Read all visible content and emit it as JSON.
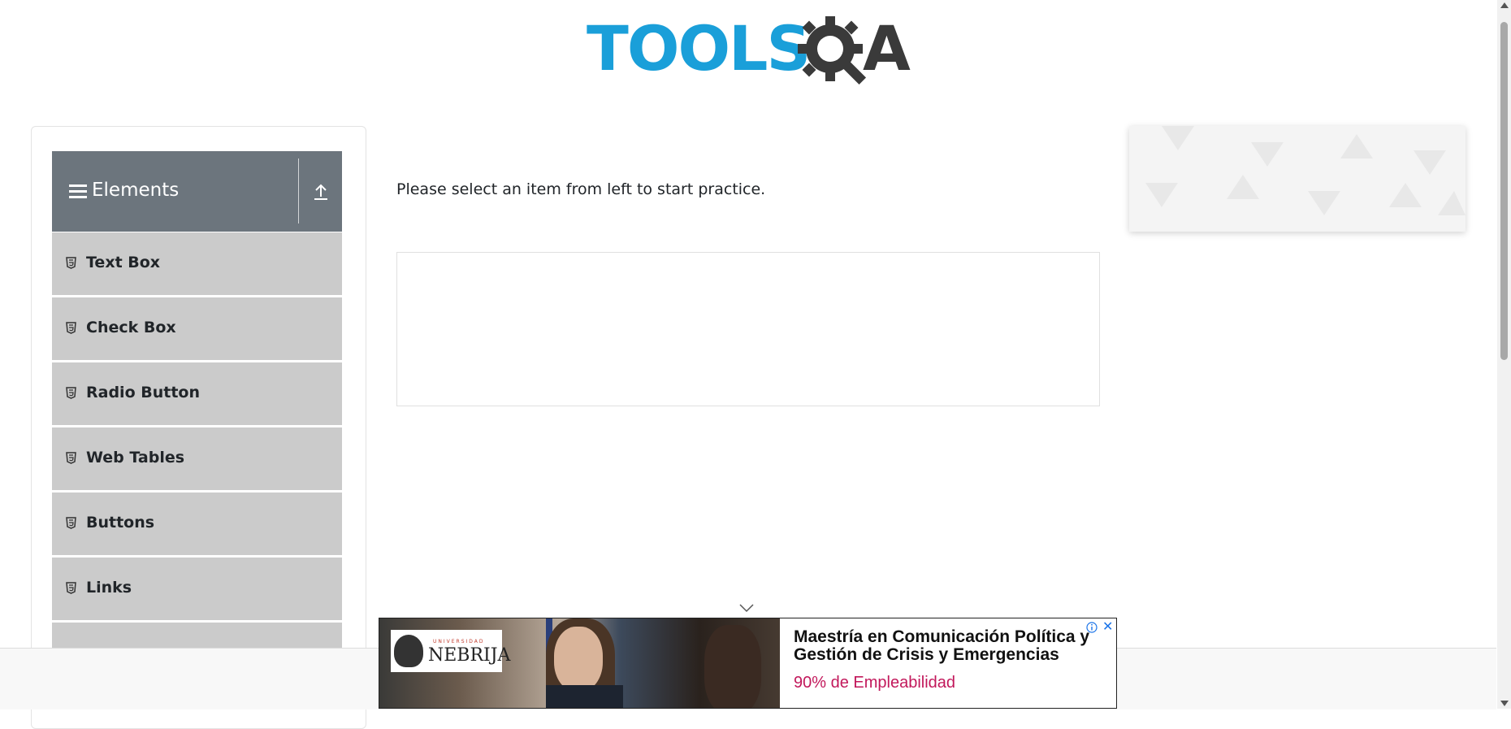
{
  "brand": {
    "logo_left": "TOOLS",
    "logo_right": "A",
    "colors": {
      "blue": "#1a9fd9",
      "dark": "#3a3a3a"
    }
  },
  "sidebar": {
    "group_title": "Elements",
    "group_icon": "menu-icon",
    "toggle_icon": "collapse-up-icon",
    "items": [
      {
        "label": "Text Box",
        "icon": "html5-icon"
      },
      {
        "label": "Check Box",
        "icon": "html5-icon"
      },
      {
        "label": "Radio Button",
        "icon": "html5-icon"
      },
      {
        "label": "Web Tables",
        "icon": "html5-icon"
      },
      {
        "label": "Buttons",
        "icon": "html5-icon"
      },
      {
        "label": "Links",
        "icon": "html5-icon"
      }
    ]
  },
  "main": {
    "instruction": "Please select an item from left to start practice."
  },
  "ad": {
    "logo_top": "UNIVERSIDAD",
    "logo_name": "NEBRIJA",
    "headline": "Maestría en Comunicación Política y Gestión de Crisis y Emergencias",
    "subtext": "90% de Empleabilidad",
    "close_glyph": "✕",
    "subtext_color": "#c2185b"
  }
}
